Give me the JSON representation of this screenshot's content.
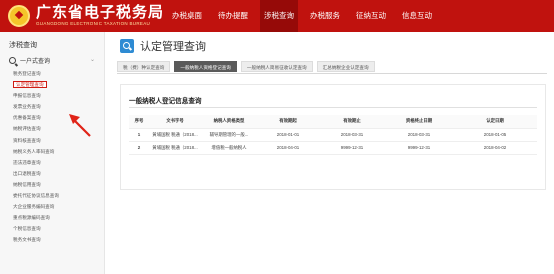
{
  "header": {
    "logo_cn": "广东省电子税务局",
    "logo_en": "GUANGDONG ELECTRONIC TAXATION BUREAU",
    "nav": [
      "办税桌面",
      "待办提醒",
      "涉税查询",
      "办税服务",
      "征纳互动",
      "信息互动"
    ],
    "active_nav": 2,
    "brand_color": "#c0120e"
  },
  "sidebar": {
    "title": "涉税查询",
    "group_label": "一户式查询",
    "items": [
      "税务登记查询",
      "认定管理查询",
      "申报信息查询",
      "发票业务查询",
      "优惠备案查询",
      "纳税评估查询",
      "资料核查查询",
      "纳税义务人率码查询",
      "违法违章查询",
      "出口退税查询",
      "纳税信用查询",
      "委托代征协议信息查询",
      "大企业服务编码查询",
      "重点税源编码查询",
      "个税信息查询",
      "税务文书查询"
    ],
    "active_index": 1
  },
  "page": {
    "title": "认定管理查询",
    "tabs": [
      "税（费）种认定查询",
      "一般纳税人资格登记查询",
      "一般纳税人简易征收认定查询",
      "汇总纳税企业认定查询"
    ],
    "active_tab": 1
  },
  "panel": {
    "title": "一般纳税人登记信息查询",
    "columns": [
      "序号",
      "文书字号",
      "纳税人资格类型",
      "有效期起",
      "有效期止",
      "资格终止日期",
      "认定日期"
    ],
    "rows": [
      [
        "1",
        "黄埔国税 税通（2018...",
        "辅导期管理的一般...",
        "2018-01-01",
        "2018-03-31",
        "2018-03-31",
        "2018-01-05"
      ],
      [
        "2",
        "黄埔国税 税通（2018...",
        "增值税一般纳税人",
        "2018-04-01",
        "9999-12-31",
        "9999-12-31",
        "2018-04-02"
      ]
    ]
  }
}
